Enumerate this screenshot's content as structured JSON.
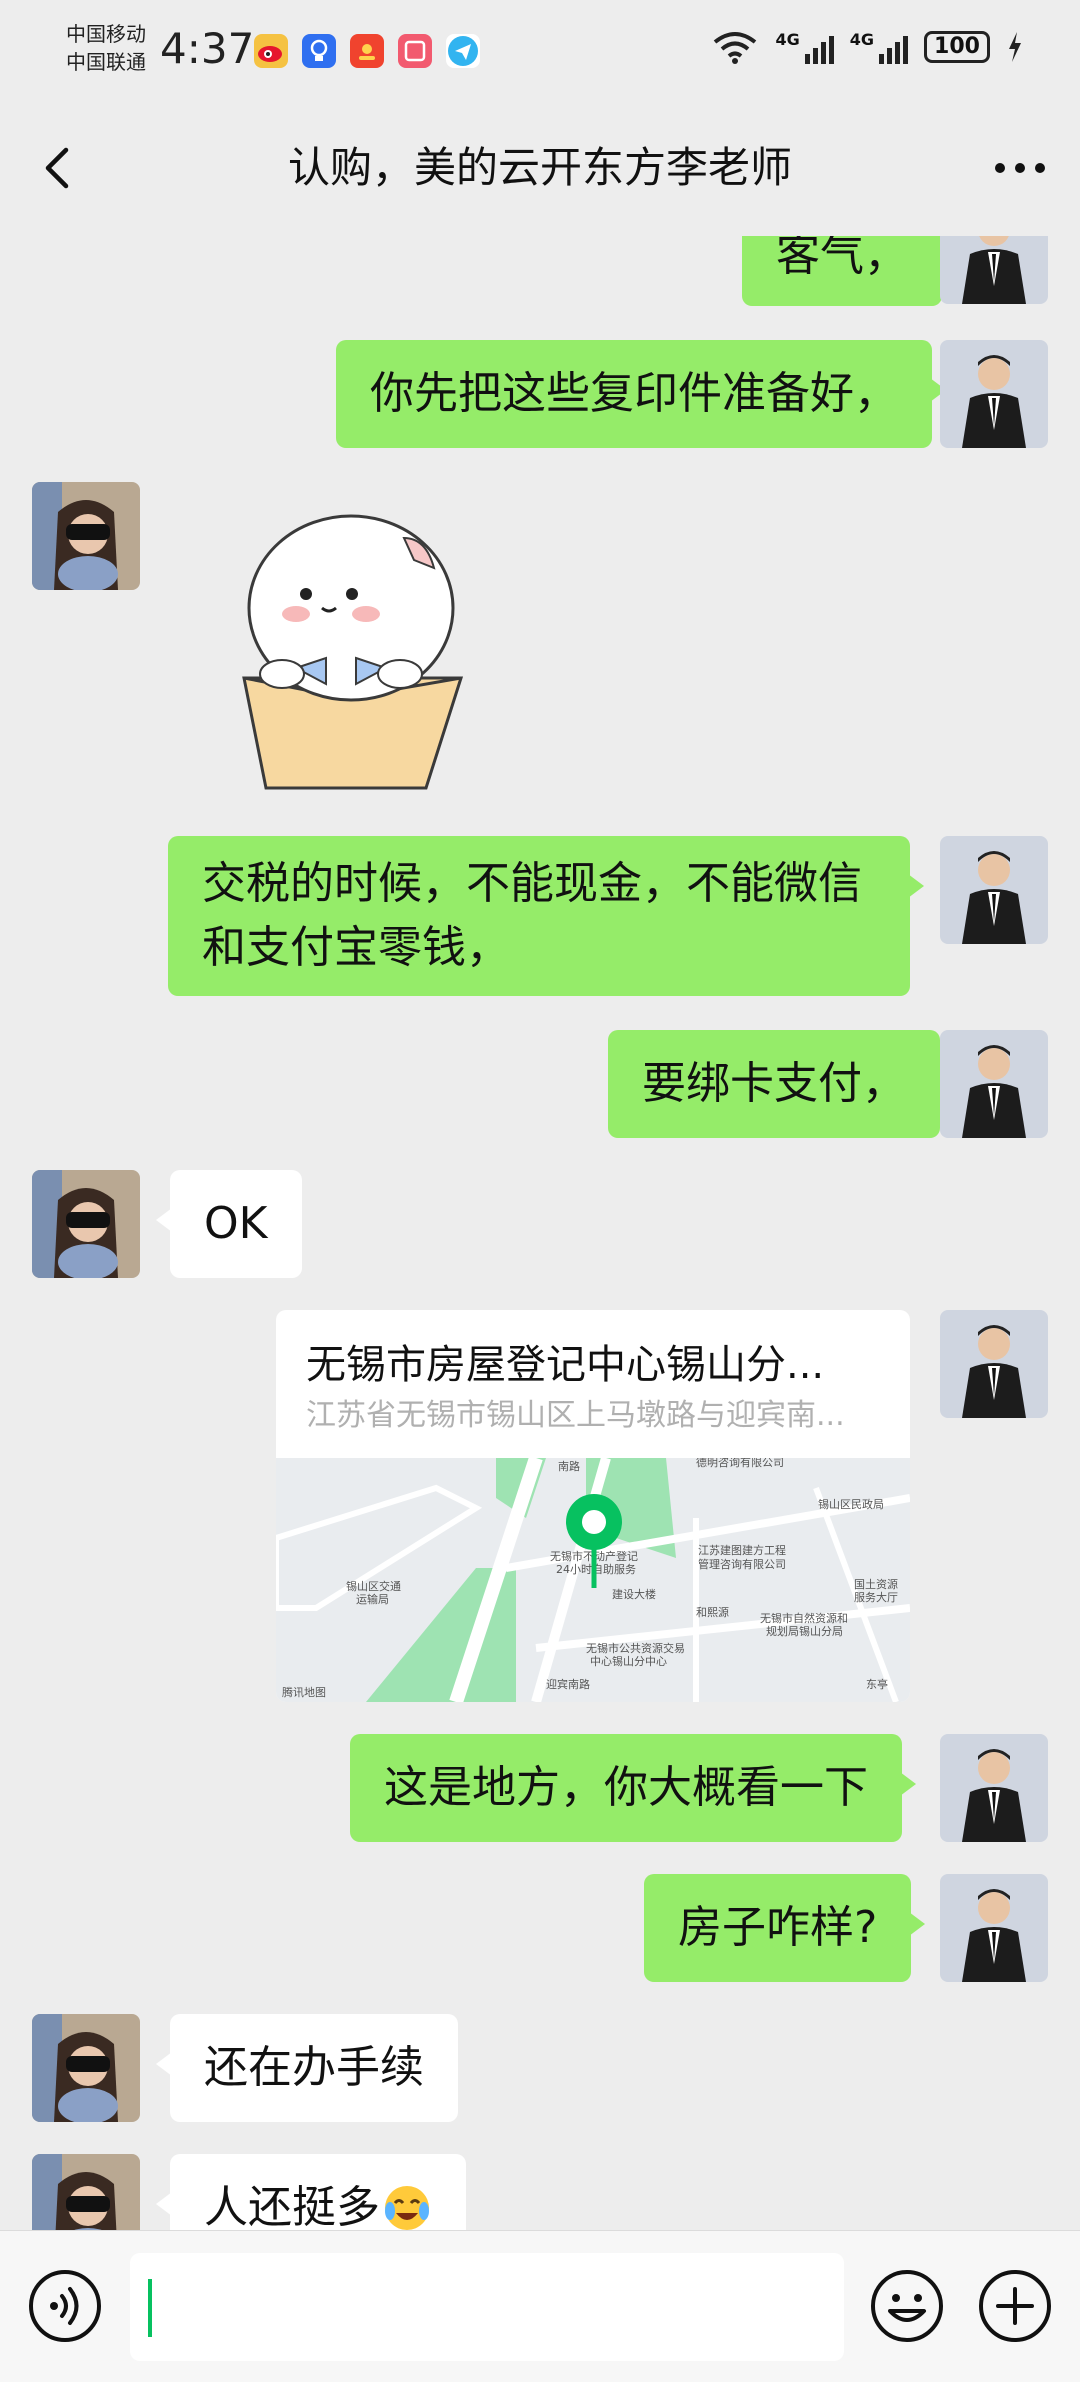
{
  "status_bar": {
    "carrier1": "中国移动",
    "carrier2": "中国联通",
    "time": "4:37",
    "network1": "4G",
    "network2": "4G",
    "battery": "100"
  },
  "header": {
    "title": "认购，美的云开东方李老师"
  },
  "messages": [
    {
      "side": "right",
      "type": "text",
      "text": "客气，"
    },
    {
      "side": "right",
      "type": "text",
      "text": "你先把这些复印件准备好，"
    },
    {
      "side": "left",
      "type": "sticker",
      "sticker": "white-cat-in-box"
    },
    {
      "side": "right",
      "type": "text",
      "text": "交税的时候，不能现金，不能微信和支付宝零钱，"
    },
    {
      "side": "right",
      "type": "text",
      "text": "要绑卡支付，"
    },
    {
      "side": "left",
      "type": "text",
      "text": "OK"
    },
    {
      "side": "right",
      "type": "location"
    },
    {
      "side": "right",
      "type": "text",
      "text": "这是地方，你大概看一下"
    },
    {
      "side": "right",
      "type": "text",
      "text": "房子咋样?"
    },
    {
      "side": "left",
      "type": "text",
      "text": "还在办手续"
    },
    {
      "side": "left",
      "type": "text",
      "text": "人还挺多"
    }
  ],
  "location": {
    "title": "无锡市房屋登记中心锡山分...",
    "address": "江苏省无锡市锡山区上马墩路与迎宾南...",
    "map_labels": {
      "road_top": "南路",
      "place1_line1": "无锡市不动产登记",
      "place1_line2": "24小时自助服务",
      "building": "建设大楼",
      "company_line1": "江苏建图建方工程",
      "company_line2": "管理咨询有限公司",
      "resident": "锡山区民政局",
      "land_line1": "国土资源",
      "land_line2": "服务大厅",
      "traffic_line1": "锡山区交通",
      "traffic_line2": "运输局",
      "yangshen": "和熙源",
      "planning_line1": "无锡市自然资源和",
      "planning_line2": "规划局锡山分局",
      "public_line1": "无锡市公共资源交易",
      "public_line2": "中心锡山分中心",
      "road_left": "迎宾南路",
      "road_right": "东亭",
      "top_right": "德明咨询有限公司",
      "attribution": "腾讯地图"
    }
  },
  "input": {
    "placeholder": ""
  },
  "icons": {
    "back": "chevron-left-icon",
    "more": "more-horizontal-icon",
    "voice": "voice-icon",
    "emoji": "emoji-icon",
    "plus": "plus-icon",
    "pin": "map-pin-icon"
  },
  "colors": {
    "background": "#ededed",
    "bubble_outgoing": "#95ec69",
    "bubble_incoming": "#ffffff",
    "accent": "#07c160"
  }
}
